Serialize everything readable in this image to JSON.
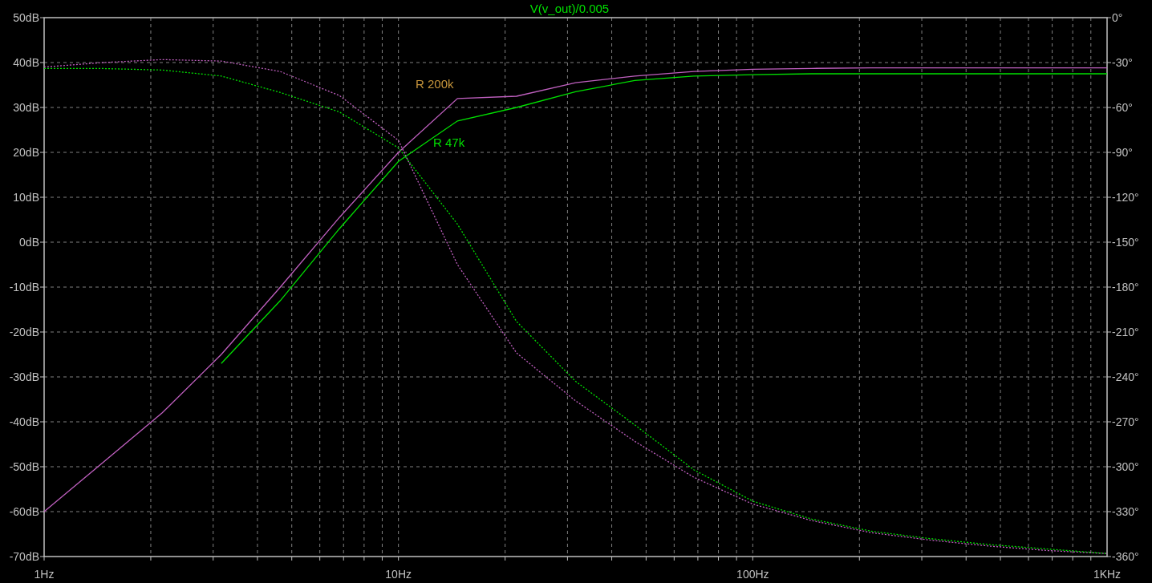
{
  "plot": {
    "title": "V(v_out)/0.005",
    "trace_labels": [
      {
        "text": "R 200k",
        "color": "#c8963c"
      },
      {
        "text": "R 47k",
        "color": "#00e000"
      }
    ],
    "magnitude": {
      "chart_data": {
        "type": "line",
        "grid": true,
        "categories": [
          "1Hz",
          null,
          null,
          null,
          null,
          null,
          "10Hz",
          null,
          null,
          null,
          null,
          null,
          "100Hz",
          null,
          null,
          null,
          null,
          null,
          "1KHz"
        ],
        "ylim": [
          -70,
          50
        ],
        "yticks": [
          {
            "value": 50,
            "label": "50dB"
          },
          {
            "value": 40,
            "label": "40dB"
          },
          {
            "value": 30,
            "label": "30dB"
          },
          {
            "value": 20,
            "label": "20dB"
          },
          {
            "value": 10,
            "label": "10dB"
          },
          {
            "value": 0,
            "label": "0dB"
          },
          {
            "value": -10,
            "label": "-10dB"
          },
          {
            "value": -20,
            "label": "-20dB"
          },
          {
            "value": -30,
            "label": "-30dB"
          },
          {
            "value": -40,
            "label": "-40dB"
          },
          {
            "value": -50,
            "label": "-50dB"
          },
          {
            "value": -60,
            "label": "-60dB"
          },
          {
            "value": -70,
            "label": "-70dB"
          }
        ],
        "series": [
          {
            "color": "#c060c0",
            "values": [
              -60,
              -49,
              -38,
              -25,
              -10,
              5.5,
              20,
              32,
              32.5,
              35.5,
              37,
              38,
              38.5,
              38.7,
              38.8,
              38.8,
              38.8,
              38.8,
              38.8
            ]
          },
          {
            "color": "#00e000",
            "values": [
              null,
              null,
              null,
              -27,
              -13,
              3,
              18,
              27,
              30,
              33.5,
              36,
              37,
              37.3,
              37.5,
              37.5,
              37.5,
              37.5,
              37.5,
              37.5
            ]
          }
        ]
      }
    },
    "phase": {
      "chart_data": {
        "type": "line",
        "categories": [
          null,
          null,
          null,
          null,
          null,
          null,
          null,
          null,
          null,
          null,
          null,
          null,
          null,
          null,
          null,
          null,
          null,
          null,
          null
        ],
        "ylim": [
          -360,
          0
        ],
        "yticks": [
          {
            "value": 0,
            "label": "0°"
          },
          {
            "value": -30,
            "label": "-30°"
          },
          {
            "value": -60,
            "label": "-60°"
          },
          {
            "value": -90,
            "label": "-90°"
          },
          {
            "value": -120,
            "label": "-120°"
          },
          {
            "value": -150,
            "label": "-150°"
          },
          {
            "value": -180,
            "label": "-180°"
          },
          {
            "value": -210,
            "label": "-210°"
          },
          {
            "value": -240,
            "label": "-240°"
          },
          {
            "value": -270,
            "label": "-270°"
          },
          {
            "value": -300,
            "label": "-300°"
          },
          {
            "value": -330,
            "label": "-330°"
          },
          {
            "value": -360,
            "label": "-360°"
          }
        ],
        "series": [
          {
            "color": "#c060c0",
            "line_style": "dashed",
            "values": [
              -33,
              -30,
              -28,
              -29,
              -36,
              -52,
              -82,
              -165,
              -224,
              -256,
              -283,
              -307,
              -325,
              -336,
              -344,
              -349,
              -353,
              -356,
              -358
            ]
          },
          {
            "color": "#00e000",
            "line_style": "dashed",
            "values": [
              -34,
              -34,
              -35,
              -39,
              -50,
              -63,
              -87,
              -138,
              -203,
              -243,
              -272,
              -302,
              -323,
              -335,
              -343,
              -348,
              -352,
              -355,
              -358
            ]
          }
        ]
      }
    }
  }
}
